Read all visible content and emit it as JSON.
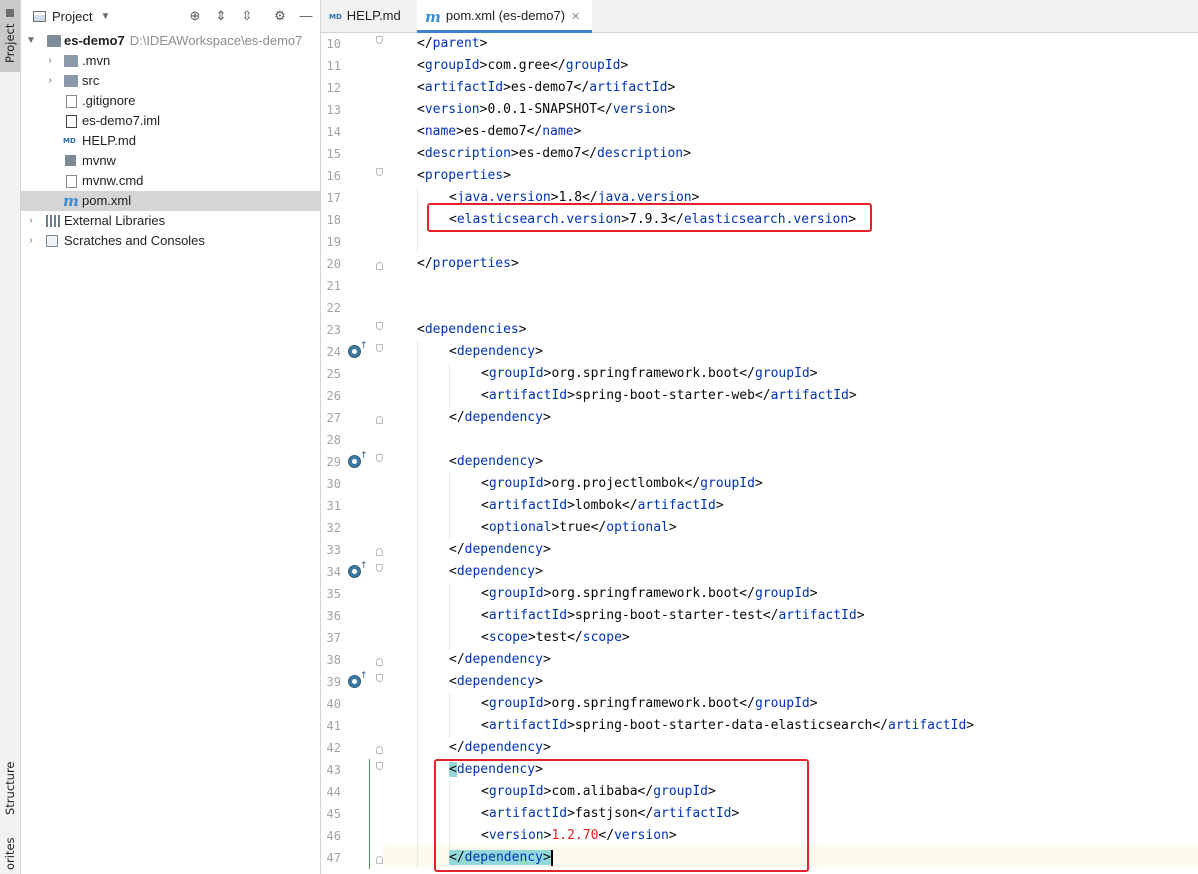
{
  "sidebar": {
    "tab_project": "Project",
    "tab_structure": "Structure",
    "tab_favorites": "orites"
  },
  "project_panel": {
    "title": "Project",
    "root": {
      "name": "es-demo7",
      "path": "D:\\IDEAWorkspace\\es-demo7"
    },
    "items": [
      {
        "label": ".mvn",
        "icon": "folder-icon"
      },
      {
        "label": "src",
        "icon": "folder-icon"
      },
      {
        "label": ".gitignore",
        "icon": "gitignore-file-icon"
      },
      {
        "label": "es-demo7.iml",
        "icon": "iml-file-icon"
      },
      {
        "label": "HELP.md",
        "icon": "markdown-file-icon"
      },
      {
        "label": "mvnw",
        "icon": "script-file-icon"
      },
      {
        "label": "mvnw.cmd",
        "icon": "cmd-file-icon"
      },
      {
        "label": "pom.xml",
        "icon": "maven-file-icon"
      }
    ],
    "external_libraries": "External Libraries",
    "scratches": "Scratches and Consoles"
  },
  "tabs": [
    {
      "label": "HELP.md",
      "badge": "MD"
    },
    {
      "label": "pom.xml (es-demo7)",
      "badge": "m"
    }
  ],
  "editor": {
    "line_numbers": [
      "10",
      "11",
      "12",
      "13",
      "14",
      "15",
      "16",
      "17",
      "18",
      "19",
      "20",
      "21",
      "22",
      "23",
      "24",
      "25",
      "26",
      "27",
      "28",
      "29",
      "30",
      "31",
      "32",
      "33",
      "34",
      "35",
      "36",
      "37",
      "38",
      "39",
      "40",
      "41",
      "42",
      "43",
      "44",
      "45",
      "46",
      "47"
    ],
    "lines": {
      "l10": [
        "</",
        "parent",
        ">"
      ],
      "l11": [
        "<",
        "groupId",
        ">com.gree</",
        "groupId",
        ">"
      ],
      "l12": [
        "<",
        "artifactId",
        ">es-demo7</",
        "artifactId",
        ">"
      ],
      "l13": [
        "<",
        "version",
        ">0.0.1-SNAPSHOT</",
        "version",
        ">"
      ],
      "l14": [
        "<",
        "name",
        ">es-demo7</",
        "name",
        ">"
      ],
      "l15": [
        "<",
        "description",
        ">es-demo7</",
        "description",
        ">"
      ],
      "l16": [
        "<",
        "properties",
        ">"
      ],
      "l17": [
        "<",
        "java.version",
        ">1.8</",
        "java.version",
        ">"
      ],
      "l18": [
        "<",
        "elasticsearch.version",
        ">7.9.3</",
        "elasticsearch.version",
        ">"
      ],
      "l20": [
        "</",
        "properties",
        ">"
      ],
      "l23": [
        "<",
        "dependencies",
        ">"
      ],
      "l24": [
        "<",
        "dependency",
        ">"
      ],
      "l25": [
        "<",
        "groupId",
        ">org.springframework.boot</",
        "groupId",
        ">"
      ],
      "l26": [
        "<",
        "artifactId",
        ">spring-boot-starter-web</",
        "artifactId",
        ">"
      ],
      "l27": [
        "</",
        "dependency",
        ">"
      ],
      "l29": [
        "<",
        "dependency",
        ">"
      ],
      "l30": [
        "<",
        "groupId",
        ">org.projectlombok</",
        "groupId",
        ">"
      ],
      "l31": [
        "<",
        "artifactId",
        ">lombok</",
        "artifactId",
        ">"
      ],
      "l32": [
        "<",
        "optional",
        ">true</",
        "optional",
        ">"
      ],
      "l33": [
        "</",
        "dependency",
        ">"
      ],
      "l34": [
        "<",
        "dependency",
        ">"
      ],
      "l35": [
        "<",
        "groupId",
        ">org.springframework.boot</",
        "groupId",
        ">"
      ],
      "l36": [
        "<",
        "artifactId",
        ">spring-boot-starter-test</",
        "artifactId",
        ">"
      ],
      "l37": [
        "<",
        "scope",
        ">test</",
        "scope",
        ">"
      ],
      "l38": [
        "</",
        "dependency",
        ">"
      ],
      "l39": [
        "<",
        "dependency",
        ">"
      ],
      "l40": [
        "<",
        "groupId",
        ">org.springframework.boot</",
        "groupId",
        ">"
      ],
      "l41": [
        "<",
        "artifactId",
        ">spring-boot-starter-data-elasticsearch</",
        "artifactId",
        ">"
      ],
      "l42": [
        "</",
        "dependency",
        ">"
      ],
      "l43": [
        "<",
        "dependency",
        ">"
      ],
      "l44": [
        "<",
        "groupId",
        ">com.alibaba</",
        "groupId",
        ">"
      ],
      "l45": [
        "<",
        "artifactId",
        ">fastjson</",
        "artifactId",
        ">"
      ],
      "l46": [
        "<",
        "version",
        ">",
        "1.2.70",
        "</",
        "version",
        ">"
      ],
      "l47": [
        "</",
        "dependency",
        ">"
      ]
    }
  },
  "colors": {
    "tag": "#0033b3",
    "highlight_box": "#e3242b",
    "version_value": "#e02020",
    "matched_tag_bg": "#93d9d9"
  }
}
